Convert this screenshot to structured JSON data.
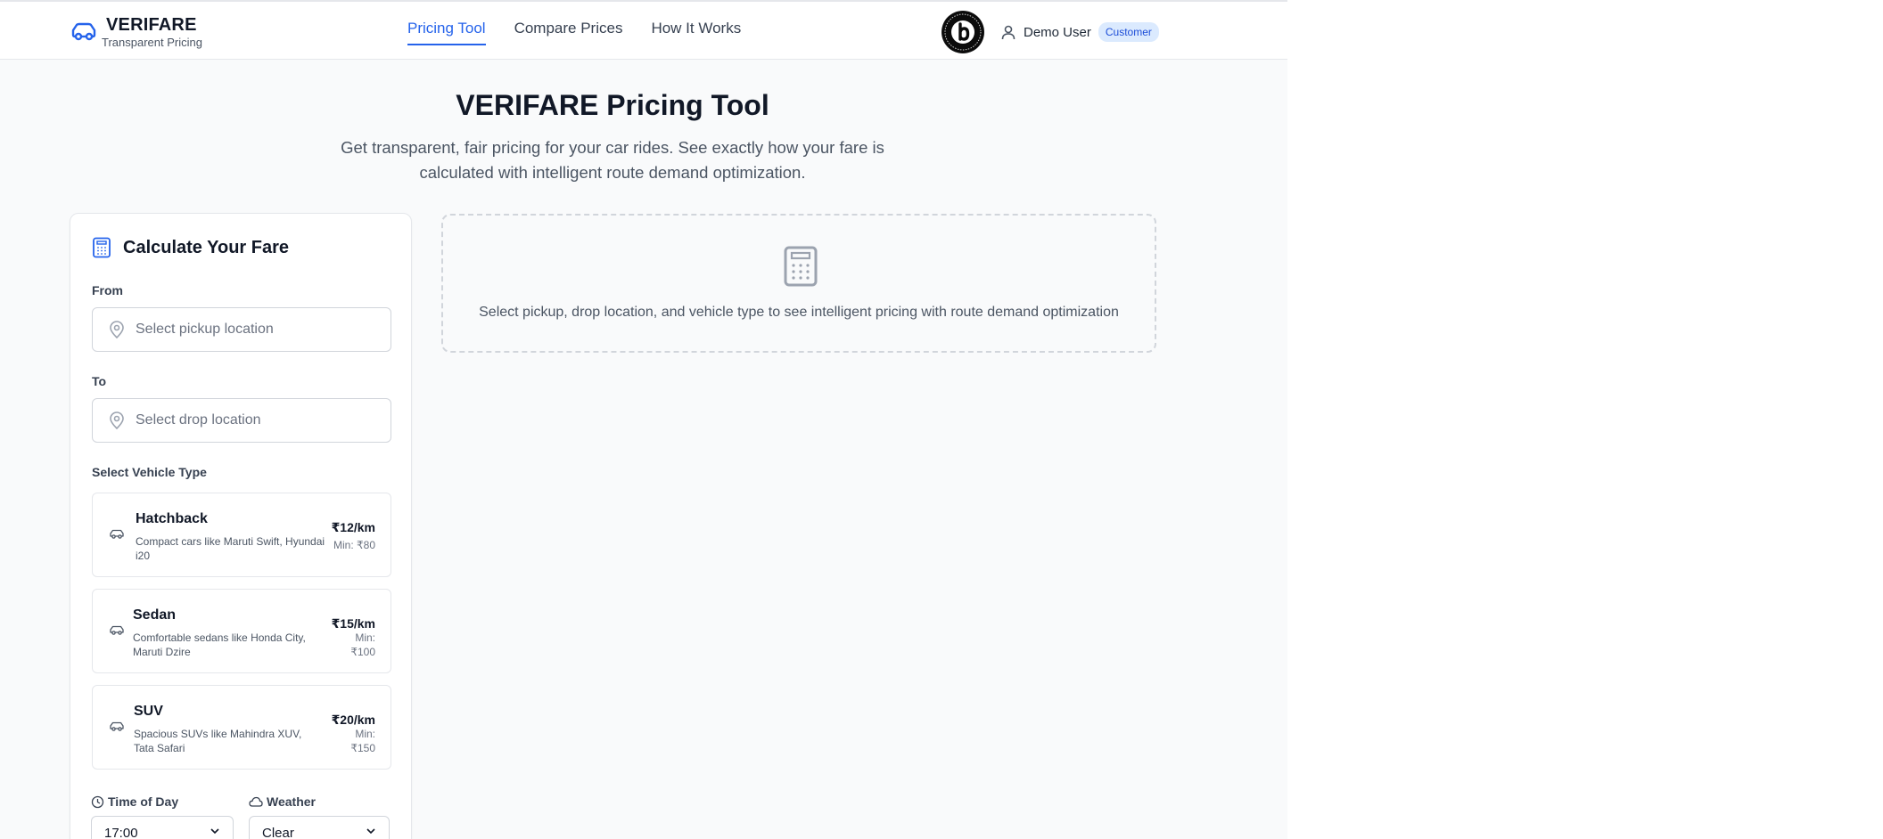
{
  "header": {
    "brand_name": "VERIFARE",
    "brand_tagline": "Transparent Pricing",
    "nav": [
      {
        "label": "Pricing Tool",
        "active": true
      },
      {
        "label": "Compare Prices",
        "active": false
      },
      {
        "label": "How It Works",
        "active": false
      }
    ],
    "user_name": "Demo User",
    "user_role": "Customer"
  },
  "hero": {
    "title": "VERIFARE Pricing Tool",
    "subtitle": "Get transparent, fair pricing for your car rides. See exactly how your fare is calculated with intelligent route demand optimization."
  },
  "calculator": {
    "title": "Calculate Your Fare",
    "from_label": "From",
    "from_placeholder": "Select pickup location",
    "to_label": "To",
    "to_placeholder": "Select drop location",
    "vehicle_label": "Select Vehicle Type",
    "vehicles": [
      {
        "name": "Hatchback",
        "description": "Compact cars like Maruti Swift, Hyundai i20",
        "rate": "₹12/km",
        "min": "Min: ₹80"
      },
      {
        "name": "Sedan",
        "description": "Comfortable sedans like Honda City, Maruti Dzire",
        "rate": "₹15/km",
        "min": "Min: ₹100"
      },
      {
        "name": "SUV",
        "description": "Spacious SUVs like Mahindra XUV, Tata Safari",
        "rate": "₹20/km",
        "min": "Min: ₹150"
      }
    ],
    "time_label": "Time of Day",
    "time_value": "17:00",
    "weather_label": "Weather",
    "weather_value": "Clear"
  },
  "result": {
    "empty_message": "Select pickup, drop location, and vehicle type to see intelligent pricing with route demand optimization"
  },
  "colors": {
    "accent": "#2563eb",
    "page_bg": "#f9fafb",
    "badge_bg": "#dbeafe"
  },
  "icons": [
    "car-icon",
    "user-icon",
    "calculator-icon",
    "map-pin-icon",
    "clock-icon",
    "cloud-icon",
    "chevron-down-icon"
  ]
}
